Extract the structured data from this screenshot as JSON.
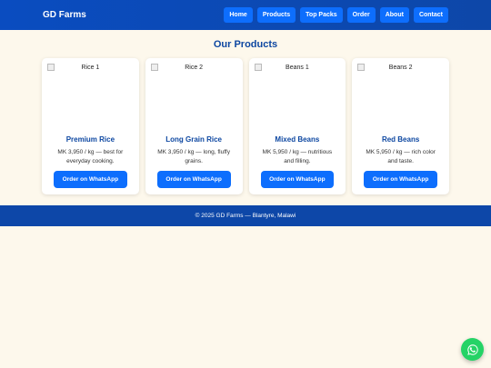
{
  "header": {
    "brand": "GD Farms",
    "nav": [
      {
        "label": "Home"
      },
      {
        "label": "Products"
      },
      {
        "label": "Top Packs"
      },
      {
        "label": "Order"
      },
      {
        "label": "About"
      },
      {
        "label": "Contact"
      }
    ]
  },
  "products": {
    "title": "Our Products",
    "items": [
      {
        "image_alt": "Rice 1",
        "name": "Premium Rice",
        "desc": "MK 3,950 / kg — best for everyday cooking.",
        "cta": "Order on WhatsApp"
      },
      {
        "image_alt": "Rice 2",
        "name": "Long Grain Rice",
        "desc": "MK 3,950 / kg — long, fluffy grains.",
        "cta": "Order on WhatsApp"
      },
      {
        "image_alt": "Beans 1",
        "name": "Mixed Beans",
        "desc": "MK 5,950 / kg — nutritious and filling.",
        "cta": "Order on WhatsApp"
      },
      {
        "image_alt": "Beans 2",
        "name": "Red Beans",
        "desc": "MK 5,950 / kg — rich color and taste.",
        "cta": "Order on WhatsApp"
      }
    ]
  },
  "footer": {
    "text": "© 2025 GD Farms — Blantyre, Malawi"
  },
  "whatsapp_fab": {
    "icon": "whatsapp-icon",
    "color": "#25d366"
  }
}
